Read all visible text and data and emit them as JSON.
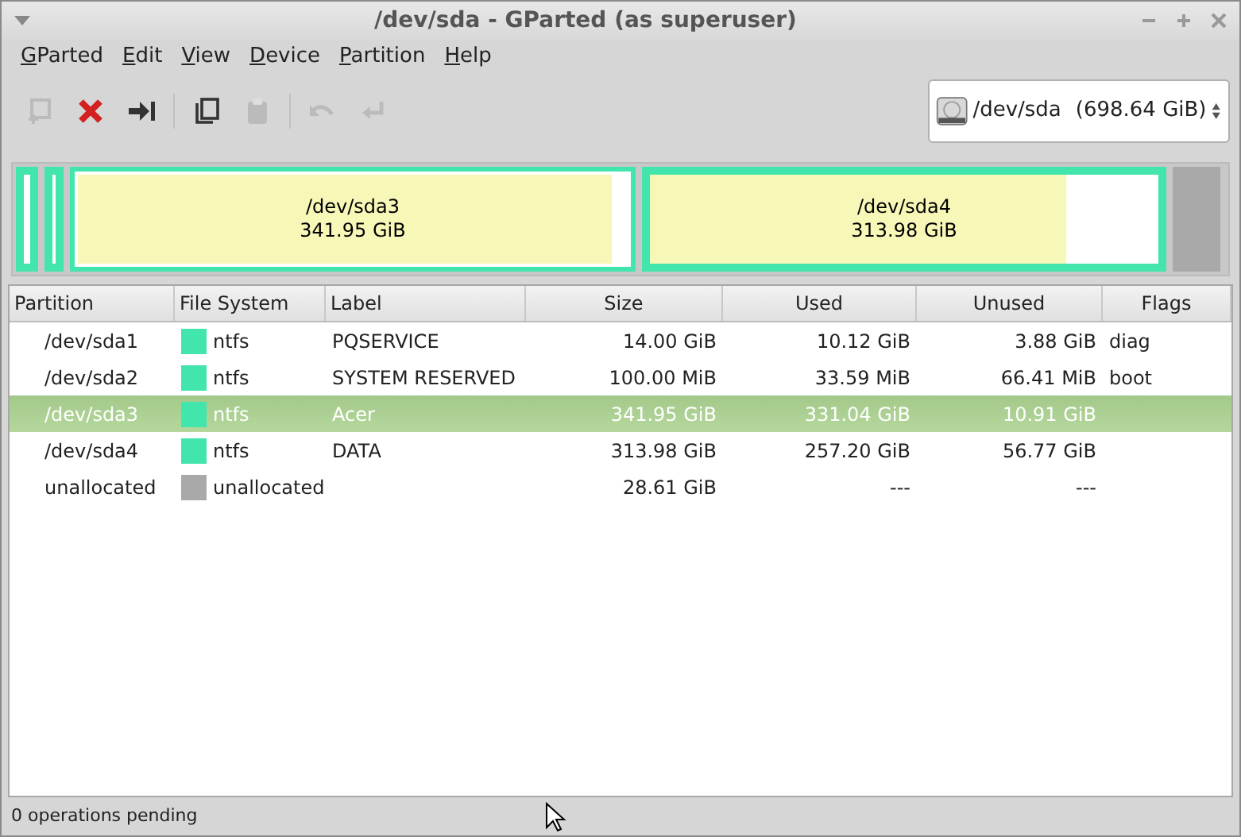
{
  "window": {
    "title": "/dev/sda - GParted (as superuser)"
  },
  "menu": [
    "GParted",
    "Edit",
    "View",
    "Device",
    "Partition",
    "Help"
  ],
  "toolbar": [
    {
      "kind": "new",
      "disabled": true
    },
    {
      "kind": "delete",
      "disabled": false
    },
    {
      "kind": "resize",
      "disabled": false
    },
    {
      "kind": "separator"
    },
    {
      "kind": "copy",
      "disabled": false
    },
    {
      "kind": "paste",
      "disabled": true
    },
    {
      "kind": "separator"
    },
    {
      "kind": "undo",
      "disabled": true
    },
    {
      "kind": "apply",
      "disabled": true
    }
  ],
  "device": {
    "name": "/dev/sda",
    "size": "(698.64 GiB)"
  },
  "disk_map": [
    {
      "kind": "partition",
      "selected": false
    },
    {
      "kind": "partition",
      "selected": false
    },
    {
      "kind": "partition",
      "name": "/dev/sda3",
      "size": "341.95 GiB",
      "level": 0.97,
      "selected": true
    },
    {
      "kind": "partition",
      "name": "/dev/sda4",
      "size": "313.98 GiB",
      "level": 0.82,
      "selected": false
    },
    {
      "kind": "unallocated"
    }
  ],
  "table": {
    "columns": [
      "Partition",
      "File System",
      "Label",
      "Size",
      "Used",
      "Unused",
      "Flags"
    ],
    "rows": [
      {
        "partition": "/dev/sda1",
        "fs": "ntfs",
        "color": "#42e5ac",
        "label": "PQSERVICE",
        "size": "14.00 GiB",
        "used": "10.12 GiB",
        "unused": "3.88 GiB",
        "flags": "diag",
        "selected": false
      },
      {
        "partition": "/dev/sda2",
        "fs": "ntfs",
        "color": "#42e5ac",
        "label": "SYSTEM RESERVED",
        "size": "100.00 MiB",
        "used": "33.59 MiB",
        "unused": "66.41 MiB",
        "flags": "boot",
        "selected": false
      },
      {
        "partition": "/dev/sda3",
        "fs": "ntfs",
        "color": "#42e5ac",
        "label": "Acer",
        "size": "341.95 GiB",
        "used": "331.04 GiB",
        "unused": "10.91 GiB",
        "selected": true
      },
      {
        "partition": "/dev/sda4",
        "fs": "ntfs",
        "color": "#42e5ac",
        "label": "DATA",
        "size": "313.98 GiB",
        "used": "257.20 GiB",
        "unused": "56.77 GiB",
        "selected": false
      },
      {
        "partition": "unallocated",
        "fs": "unallocated",
        "color": "#a9a9a9",
        "size": "28.61 GiB",
        "used": "---",
        "unused": "---",
        "selected": false
      }
    ]
  },
  "status_bar": "0 operations pending"
}
